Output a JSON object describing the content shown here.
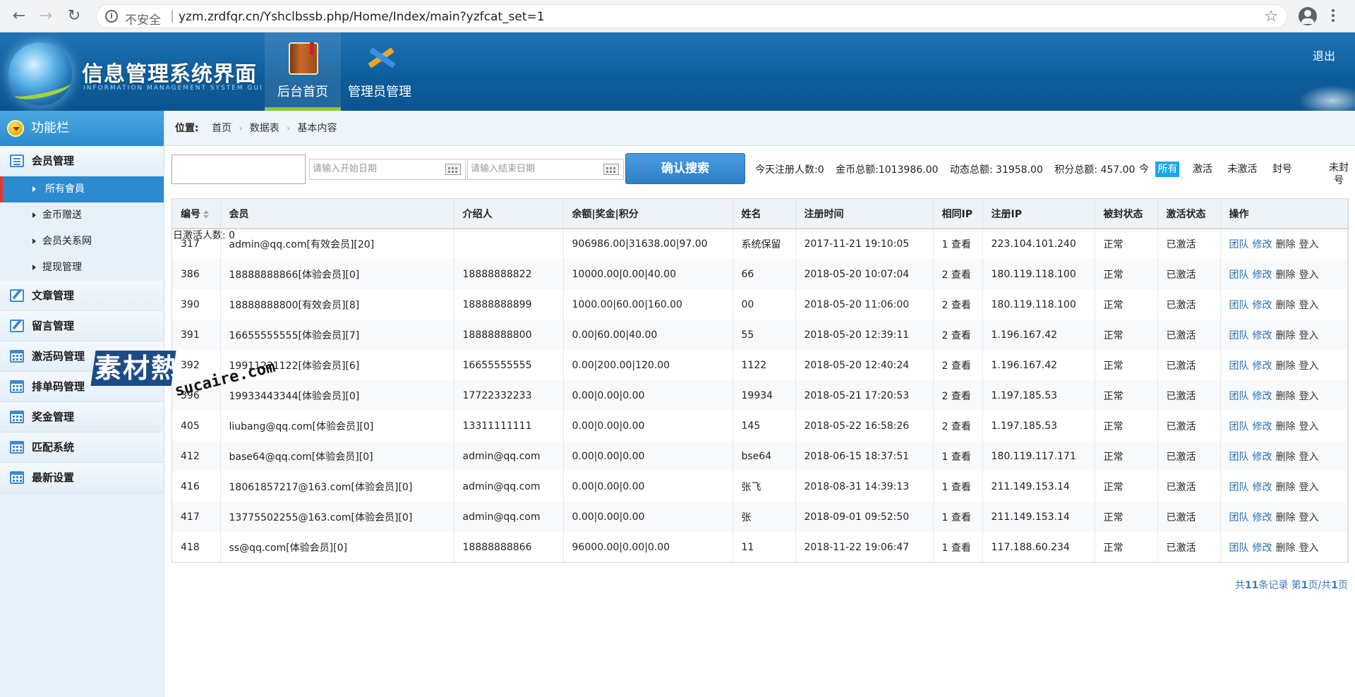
{
  "browser": {
    "back": "←",
    "forward": "→",
    "reload": "↻",
    "info": "i",
    "insecure": "不安全",
    "separator": "|",
    "url": "yzm.zrdfqr.cn/Yshclbssb.php/Home/Index/main?yzfcat_set=1",
    "star": "☆"
  },
  "header": {
    "title": "信息管理系统界面",
    "subtitle": "INFORMATION MANAGEMENT SYSTEM GUI",
    "tabs": [
      {
        "label": "后台首页",
        "active": true
      },
      {
        "label": "管理员管理",
        "active": false
      }
    ],
    "logout": "退出"
  },
  "sidebar": {
    "title": "功能栏",
    "member_group": "会员管理",
    "member_items": [
      "所有會員",
      "金币赠送",
      "会员关系网",
      "提现管理"
    ],
    "groups": [
      "文章管理",
      "留言管理",
      "激活码管理",
      "排单码管理",
      "奖金管理",
      "匹配系统",
      "最新设置"
    ]
  },
  "watermark": {
    "cn": "素材熱",
    "en": "sucaire.com"
  },
  "breadcrumb": {
    "label": "位置:",
    "items": [
      "首页",
      "数据表",
      "基本内容"
    ]
  },
  "search": {
    "keyword_value": "",
    "start_placeholder": "请输入开始日期",
    "end_placeholder": "请输入结束日期",
    "button": "确认搜索"
  },
  "stats": {
    "today_register": "今天注册人数:0",
    "gold_total": "金币总额:1013986.00",
    "dynamic_total": "动态总额: 31958.00",
    "points_total": "积分总额: 457.00",
    "today_active": "日激活人数: 0"
  },
  "filters": {
    "prefix": "今",
    "items": [
      "所有",
      "激活",
      "未激活",
      "封号"
    ],
    "selected": "所有",
    "last": "未封号"
  },
  "table": {
    "headers": [
      "编号",
      "会员",
      "介绍人",
      "余额|奖金|积分",
      "姓名",
      "注册时间",
      "相同IP",
      "注册IP",
      "被封状态",
      "激活状态",
      "操作"
    ],
    "rows": [
      [
        "317",
        "admin@qq.com[有效会员][20]",
        "",
        "906986.00|31638.00|97.00",
        "系统保留",
        "2017-11-21 19:10:05",
        "1 查看",
        "223.104.101.240",
        "正常",
        "已激活"
      ],
      [
        "386",
        "18888888866[体验会员][0]",
        "18888888822",
        "10000.00|0.00|40.00",
        "66",
        "2018-05-20 10:07:04",
        "2 查看",
        "180.119.118.100",
        "正常",
        "已激活"
      ],
      [
        "390",
        "18888888800[有效会员][8]",
        "18888888899",
        "1000.00|60.00|160.00",
        "00",
        "2018-05-20 11:06:00",
        "2 查看",
        "180.119.118.100",
        "正常",
        "已激活"
      ],
      [
        "391",
        "16655555555[体验会员][7]",
        "18888888800",
        "0.00|60.00|40.00",
        "55",
        "2018-05-20 12:39:11",
        "2 查看",
        "1.196.167.42",
        "正常",
        "已激活"
      ],
      [
        "392",
        "19911221122[体验会员][6]",
        "16655555555",
        "0.00|200.00|120.00",
        "1122",
        "2018-05-20 12:40:24",
        "2 查看",
        "1.196.167.42",
        "正常",
        "已激活"
      ],
      [
        "396",
        "19933443344[体验会员][0]",
        "17722332233",
        "0.00|0.00|0.00",
        "19934",
        "2018-05-21 17:20:53",
        "2 查看",
        "1.197.185.53",
        "正常",
        "已激活"
      ],
      [
        "405",
        "liubang@qq.com[体验会员][0]",
        "13311111111",
        "0.00|0.00|0.00",
        "145",
        "2018-05-22 16:58:26",
        "2 查看",
        "1.197.185.53",
        "正常",
        "已激活"
      ],
      [
        "412",
        "base64@qq.com[体验会员][0]",
        "admin@qq.com",
        "0.00|0.00|0.00",
        "bse64",
        "2018-06-15 18:37:51",
        "1 查看",
        "180.119.117.171",
        "正常",
        "已激活"
      ],
      [
        "416",
        "18061857217@163.com[体验会员][0]",
        "admin@qq.com",
        "0.00|0.00|0.00",
        "张飞",
        "2018-08-31 14:39:13",
        "1 查看",
        "211.149.153.14",
        "正常",
        "已激活"
      ],
      [
        "417",
        "13775502255@163.com[体验会员][0]",
        "admin@qq.com",
        "0.00|0.00|0.00",
        "张",
        "2018-09-01 09:52:50",
        "1 查看",
        "211.149.153.14",
        "正常",
        "已激活"
      ],
      [
        "418",
        "ss@qq.com[体验会员][0]",
        "18888888866",
        "96000.00|0.00|0.00",
        "11",
        "2018-11-22 19:06:47",
        "1 查看",
        "117.188.60.234",
        "正常",
        "已激活"
      ]
    ],
    "actions": [
      "团队",
      "修改",
      "删除",
      "登入"
    ]
  },
  "pager": {
    "p1": "共",
    "total": "11",
    "p2": "条记录 第",
    "page": "1",
    "p3": "页/共",
    "pages": "1",
    "p4": "页"
  }
}
